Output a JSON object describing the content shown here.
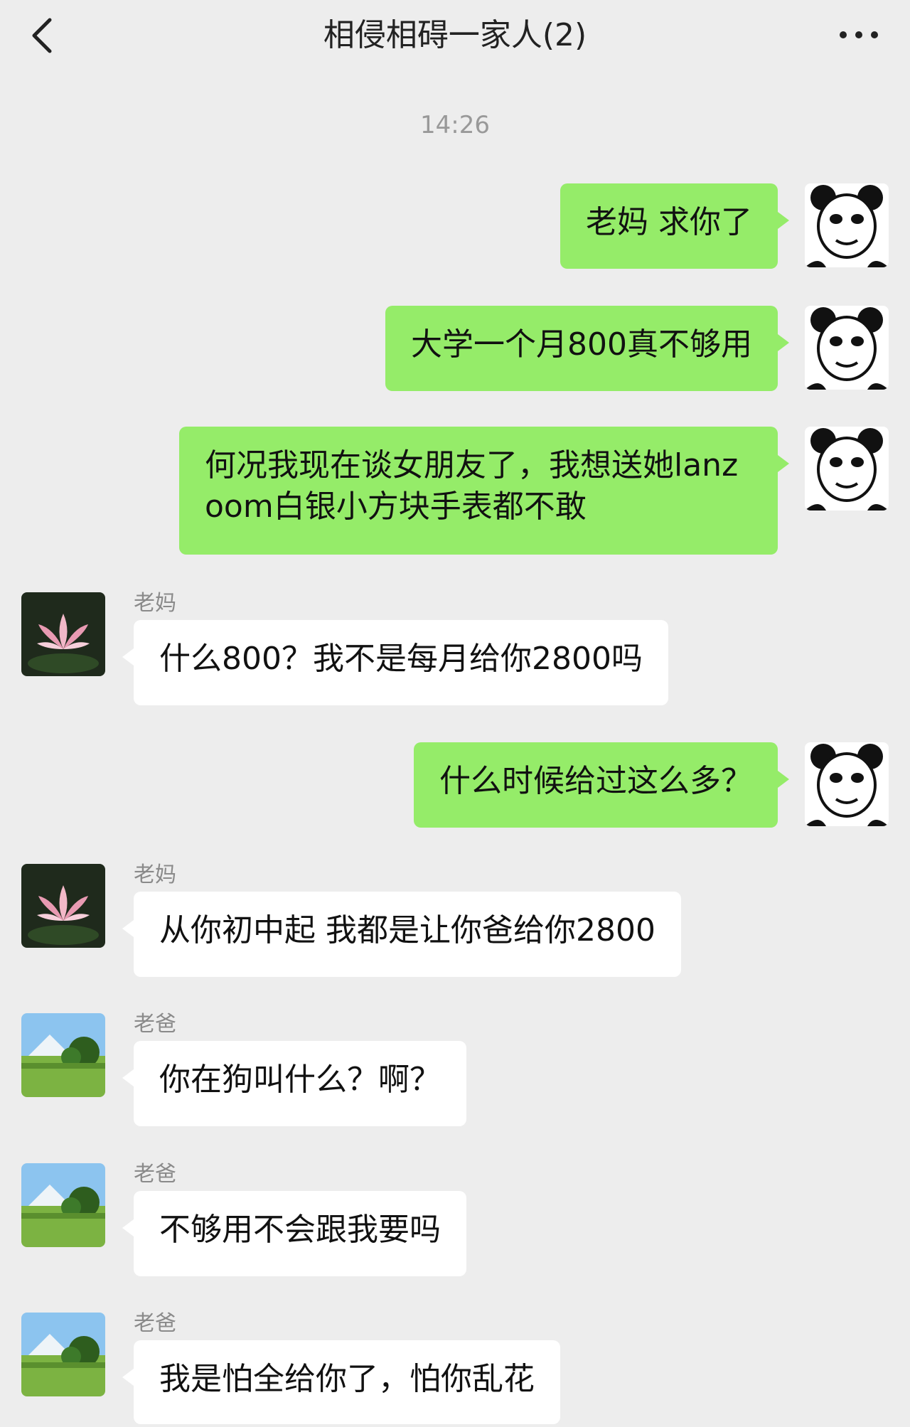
{
  "header": {
    "title": "相侵相碍一家人(2)",
    "back_icon": "chevron-left-icon",
    "more_icon": "more-dots-icon"
  },
  "chat": {
    "timestamp": "14:26",
    "messages": [
      {
        "direction": "out",
        "text": "老妈 求你了"
      },
      {
        "direction": "out",
        "text": "大学一个月800真不够用"
      },
      {
        "direction": "out",
        "text": "何况我现在谈女朋友了，我想送她lanzoom白银小方块手表都不敢"
      },
      {
        "direction": "in",
        "sender": "老妈",
        "text": "什么800？我不是每月给你2800吗"
      },
      {
        "direction": "out",
        "text": "什么时候给过这么多？"
      },
      {
        "direction": "in",
        "sender": "老妈",
        "text": "从你初中起 我都是让你爸给你2800"
      },
      {
        "direction": "in",
        "sender": "老爸",
        "text": "你在狗叫什么？啊？"
      },
      {
        "direction": "in",
        "sender": "老爸",
        "text": "不够用不会跟我要吗"
      },
      {
        "direction": "in",
        "sender": "老爸",
        "text": "我是怕全给你了，怕你乱花"
      }
    ]
  },
  "colors": {
    "background": "#ededed",
    "outgoing_bubble": "#95ec69",
    "incoming_bubble": "#ffffff"
  }
}
